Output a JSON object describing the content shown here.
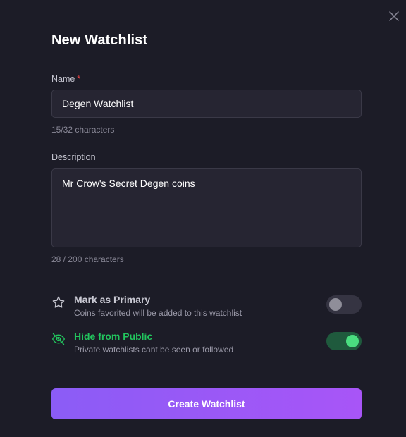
{
  "modal": {
    "title": "New Watchlist",
    "close_icon": "close-icon"
  },
  "name_field": {
    "label": "Name",
    "required_mark": "*",
    "value": "Degen Watchlist",
    "counter": "15/32 characters"
  },
  "description_field": {
    "label": "Description",
    "value": "Mr Crow's Secret Degen coins",
    "counter": "28 / 200 characters"
  },
  "options": [
    {
      "title": "Mark as Primary",
      "subtitle": "Coins favorited will be added to this watchlist",
      "icon": "star-icon",
      "enabled": false
    },
    {
      "title": "Hide from Public",
      "subtitle": "Private watchlists cant be seen or followed",
      "icon": "eye-off-icon",
      "enabled": true
    }
  ],
  "submit": {
    "label": "Create Watchlist"
  },
  "colors": {
    "background": "#1c1c27",
    "input_background": "#262532",
    "accent_green": "#22c55e",
    "button_gradient_start": "#8b5cf6",
    "button_gradient_end": "#a855f7",
    "required": "#ef4444"
  }
}
